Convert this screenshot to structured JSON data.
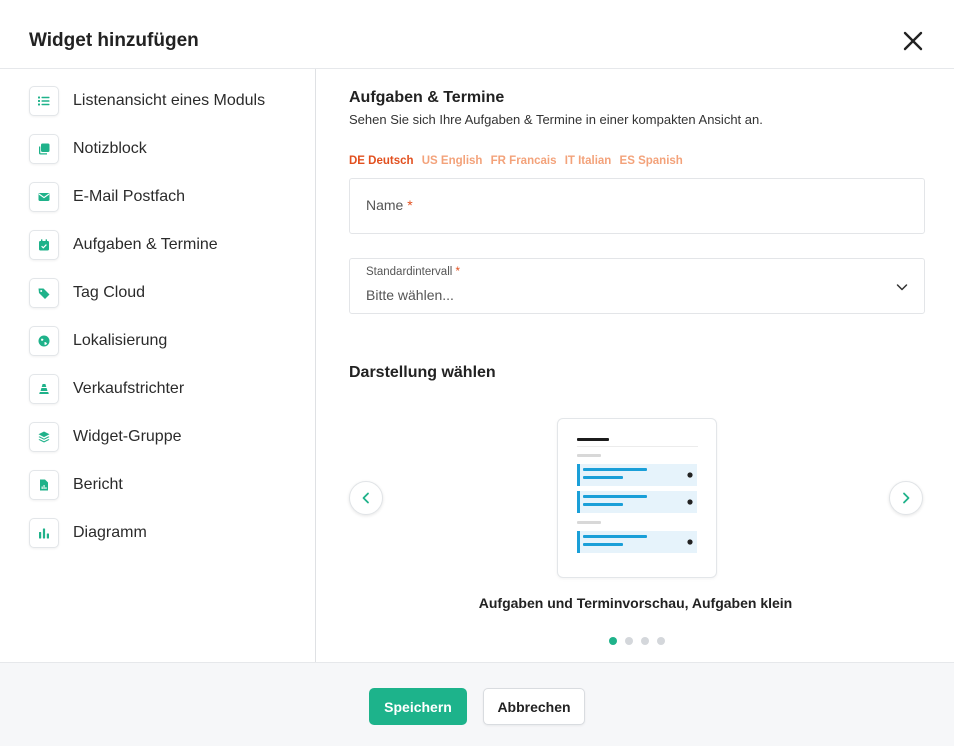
{
  "dialog": {
    "title": "Widget hinzufügen",
    "close_icon": "close-icon"
  },
  "sidebar": {
    "items": [
      {
        "label": "Listenansicht eines Moduls",
        "icon": "list-icon"
      },
      {
        "label": "Notizblock",
        "icon": "notes-icon"
      },
      {
        "label": "E-Mail Postfach",
        "icon": "envelope-icon"
      },
      {
        "label": "Aufgaben & Termine",
        "icon": "calendar-check-icon"
      },
      {
        "label": "Tag Cloud",
        "icon": "tags-icon"
      },
      {
        "label": "Lokalisierung",
        "icon": "globe-icon"
      },
      {
        "label": "Verkaufstrichter",
        "icon": "funnel-icon"
      },
      {
        "label": "Widget-Gruppe",
        "icon": "layers-icon"
      },
      {
        "label": "Bericht",
        "icon": "report-file-icon"
      },
      {
        "label": "Diagramm",
        "icon": "bar-chart-icon"
      }
    ],
    "icon_color": "#1fb28a"
  },
  "main": {
    "title": "Aufgaben & Termine",
    "description": "Sehen Sie sich Ihre Aufgaben & Termine in einer kompakten Ansicht an.",
    "languages": [
      {
        "label": "DE Deutsch",
        "active": true
      },
      {
        "label": "US English",
        "active": false
      },
      {
        "label": "FR Francais",
        "active": false
      },
      {
        "label": "IT Italian",
        "active": false
      },
      {
        "label": "ES Spanish",
        "active": false
      }
    ],
    "name_field": {
      "label": "Name",
      "required_mark": "*"
    },
    "interval_field": {
      "label": "Standardintervall",
      "required_mark": "*",
      "value": "Bitte wählen..."
    },
    "display_title": "Darstellung wählen",
    "carousel": {
      "caption": "Aufgaben und Terminvorschau, Aufgaben klein",
      "slide_count": 4,
      "active_slide": 1
    }
  },
  "footer": {
    "save_label": "Speichern",
    "cancel_label": "Abbrechen"
  },
  "colors": {
    "accent": "#1db38b",
    "language_active": "#e2501f",
    "language_inactive": "#f3a27a",
    "preview_bar": "#1a9fd8",
    "preview_row_bg": "#e6f3fb"
  }
}
